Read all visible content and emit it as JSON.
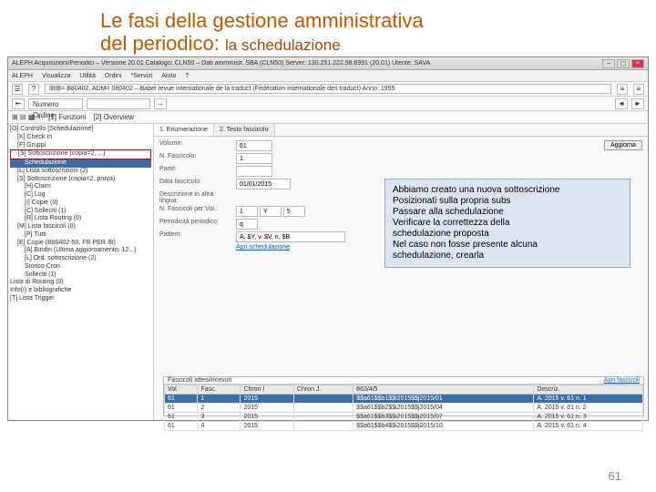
{
  "slide": {
    "title_line1": "Le fasi della gestione amministrativa",
    "title_line2_a": "del periodico:",
    "title_line2_b": " la schedulazione",
    "page_number": "61"
  },
  "window": {
    "title": "ALEPH Acquisizioni/Periodici – Versione 20.01  Catalogo: CLN50 – Dati amministr. SBA (CLN50)  Server: 130.251.222.98:6991 (20.01)  Utente: SAVA"
  },
  "menubar": [
    "ALEPH",
    "Visualizza",
    "Utilità",
    "Ordini",
    "*Servizi",
    "Aiuto",
    "?"
  ],
  "record_line": "IBIB= B80402, ADM= 080402 – Babel revue internationale de la traduct (Fédération internationale des traduct)  Anno: 1955",
  "toolbar2": {
    "label": "Numero Ordine",
    "value": " "
  },
  "toolbar3": {
    "funzioni": "[1] Funzioni",
    "overview": "[2] Overview"
  },
  "tree": [
    {
      "t": "[O] Controllo [Schedulazione]",
      "c": "n"
    },
    {
      "t": "[K] Check In",
      "c": "n i1"
    },
    {
      "t": "[F] Gruppi",
      "c": "n i1"
    },
    {
      "t": "[S] Sottoscrizione (copia=2, ...)",
      "c": "n i1 hl"
    },
    {
      "t": "Schedulazione",
      "c": "n i2 sel"
    },
    {
      "t": "[L] Lista sottoscrizioni (2)",
      "c": "n i1"
    },
    {
      "t": "[S] Sottoscrizione (copia=2, prova)",
      "c": "n i1"
    },
    {
      "t": "[H] Claim",
      "c": "n i2"
    },
    {
      "t": "[C] Log",
      "c": "n i2"
    },
    {
      "t": "[I] Copie (0)",
      "c": "n i2"
    },
    {
      "t": "[C] Solleciti (1)",
      "c": "n i2"
    },
    {
      "t": "[R] Lista Routing (0)",
      "c": "n i2"
    },
    {
      "t": "[M] Lista fascicoli (0)",
      "c": "n i1"
    },
    {
      "t": "[P] Tutti",
      "c": "n i2"
    },
    {
      "t": "[E] Copie (B80402-50, FR PER /B)",
      "c": "n i1"
    },
    {
      "t": "[A] Bindin (Ultima aggiornamento: 12...)",
      "c": "n i2"
    },
    {
      "t": "[L] Ord. sottoscrizione (2)",
      "c": "n i2"
    },
    {
      "t": "Storico Cron",
      "c": "n i2"
    },
    {
      "t": "Solleciti (1)",
      "c": "n i2"
    },
    {
      "t": "Lista di Routing (0)",
      "c": "n"
    },
    {
      "t": "Info(I) e bibliografiche",
      "c": "n"
    },
    {
      "t": "[T] Lista Trigger",
      "c": "n"
    }
  ],
  "tabs": [
    "1. Enumerazione",
    "2. Testo fascicolo"
  ],
  "form": {
    "labels": {
      "volume": "Volume:",
      "nfasc": "N. Fascicolo:",
      "partez": "Parte:",
      "datafasc": "Data fascicolo:",
      "descr": "Descrizione in altra lingua:",
      "nfascvol": "N. Fascicoli per Vol.:",
      "periodi": "Periodicità periodico:",
      "pattern": "Pattern:"
    },
    "values": {
      "volume": "61",
      "nfasc": "1",
      "partez": "",
      "datafasc": "01/01/2015",
      "fpv1": "1",
      "fpv2": "Y",
      "fpv3": "5",
      "period": "q",
      "pattern": "A. $Y, v. $V, n. $B"
    },
    "agg_btn": "Aggiorna",
    "link": "Apri schedulazione"
  },
  "callout": {
    "l1": "Abbiamo creato una nuova sottoscrizione",
    "l2": "Posizionati sulla propria subs",
    "l3": "Passare alla schedulazione",
    "l4": "Verificare la correttezza della",
    "l5": "schedulazione proposta",
    "l6": "Nel caso non fosse presente alcuna",
    "l7": "schedulazione, crearla"
  },
  "table": {
    "title": "Fascicoli attesi/ricevuti",
    "apribtn": "Apri fascicoli",
    "headers": [
      "Vol.",
      "Fasc.",
      "Chron I",
      "Chron J.",
      "863/4/5",
      "Descriz."
    ],
    "rows": [
      {
        "sel": true,
        "c": [
          "61",
          "1",
          "2015",
          "",
          "$$a61$$b1$$i2015$$j2015/01",
          "A. 2015 v. 61 n. 1"
        ]
      },
      {
        "sel": false,
        "c": [
          "61",
          "2",
          "2015",
          "",
          "$$a61$$b2$$i2015$$j2015/04",
          "A. 2015 v. 61 n. 2"
        ]
      },
      {
        "sel": false,
        "c": [
          "61",
          "3",
          "2015",
          "",
          "$$a61$$b3$$i2015$$j2015/07",
          "A. 2015 v. 61 n. 3"
        ]
      },
      {
        "sel": false,
        "c": [
          "61",
          "4",
          "2015",
          "",
          "$$a61$$b4$$i2015$$j2015/10",
          "A. 2015 v. 61 n. 4"
        ]
      }
    ]
  }
}
